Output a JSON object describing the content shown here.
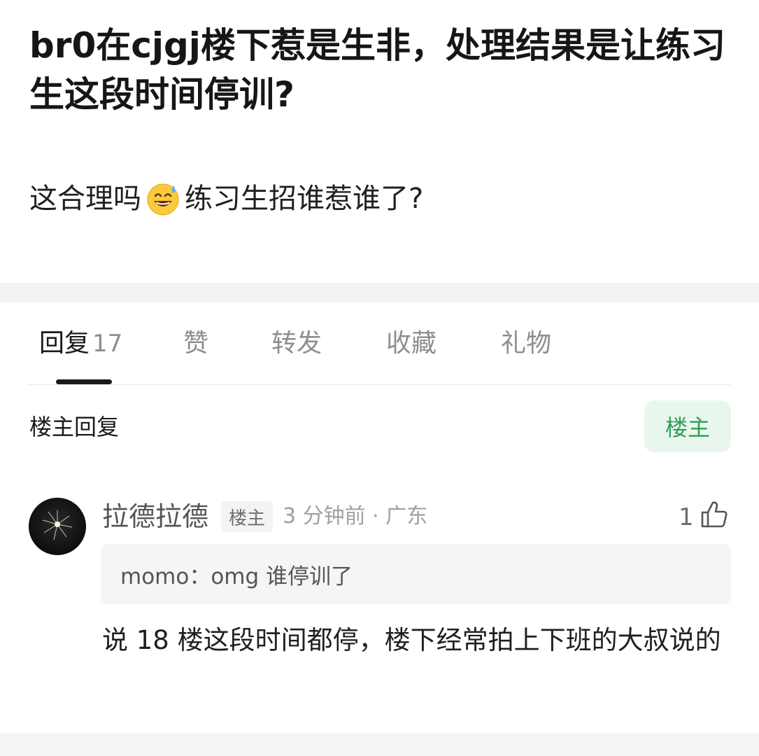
{
  "post": {
    "title": "br0在cjgj楼下惹是生非，处理结果是让练习生这段时间停训?",
    "body_before_emoji": "这合理吗",
    "emoji_icon": "grinning-face-with-sweat-icon",
    "body_after_emoji": "练习生招谁惹谁了?"
  },
  "tabs": [
    {
      "label": "回复",
      "count": "17",
      "active": true
    },
    {
      "label": "赞"
    },
    {
      "label": "转发"
    },
    {
      "label": "收藏"
    },
    {
      "label": "礼物"
    }
  ],
  "section": {
    "label": "楼主回复",
    "filter_chip": "楼主"
  },
  "reply": {
    "username": "拉德拉德",
    "badge": "楼主",
    "meta": "3 分钟前 · 广东",
    "likes": "1",
    "quote": "momo：omg 谁停训了",
    "text": "说 18 楼这段时间都停，楼下经常拍上下班的大叔说的"
  },
  "colors": {
    "accent_green": "#2e9f55",
    "chip_bg": "#e9f6ee",
    "muted_text": "#8e8e8e"
  }
}
